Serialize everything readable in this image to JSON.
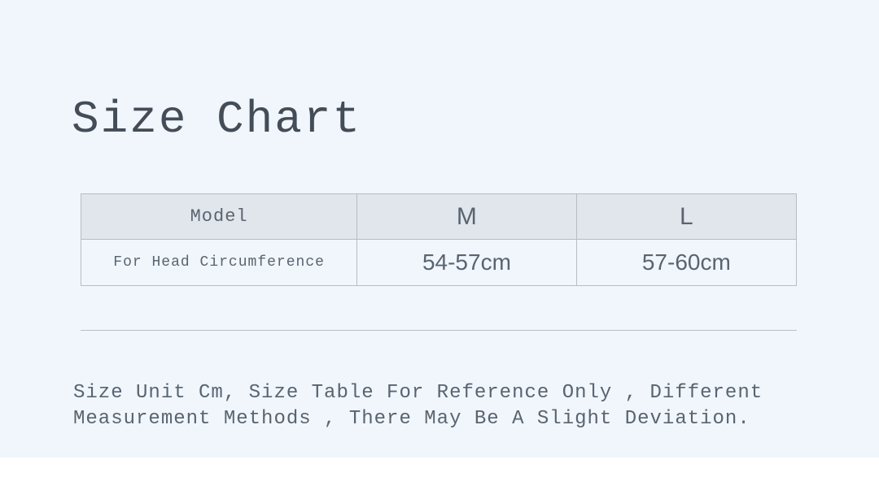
{
  "title": "Size Chart",
  "chart_data": {
    "type": "table",
    "title": "Size Chart",
    "columns": [
      "Model",
      "M",
      "L"
    ],
    "rows": [
      {
        "label": "For Head Circumference",
        "M": "54-57cm",
        "L": "57-60cm"
      }
    ]
  },
  "table": {
    "header": {
      "col0": "Model",
      "col1": "M",
      "col2": "L"
    },
    "row1": {
      "col0": "For Head Circumference",
      "col1": "54-57cm",
      "col2": "57-60cm"
    }
  },
  "note": "Size Unit Cm, Size Table For Reference Only , Different Measurement Methods , There May Be A Slight Deviation."
}
